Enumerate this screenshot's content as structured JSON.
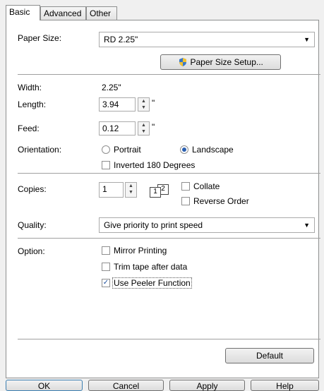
{
  "tabs": [
    {
      "label": "Basic"
    },
    {
      "label": "Advanced"
    },
    {
      "label": "Other"
    }
  ],
  "paper_size": {
    "label": "Paper Size:",
    "value": "RD 2.25\"",
    "setup_button": "Paper Size Setup..."
  },
  "width": {
    "label": "Width:",
    "value": "2.25\""
  },
  "length": {
    "label": "Length:",
    "value": "3.94",
    "unit": "\""
  },
  "feed": {
    "label": "Feed:",
    "value": "0.12",
    "unit": "\""
  },
  "orientation": {
    "label": "Orientation:",
    "portrait": "Portrait",
    "landscape": "Landscape",
    "selected": "landscape",
    "inverted": "Inverted 180 Degrees",
    "inverted_checked": false
  },
  "copies": {
    "label": "Copies:",
    "value": "1",
    "collate": "Collate",
    "collate_checked": false,
    "reverse": "Reverse Order",
    "reverse_checked": false,
    "icon_digits": [
      "1",
      "2"
    ]
  },
  "quality": {
    "label": "Quality:",
    "value": "Give priority to print speed"
  },
  "option": {
    "label": "Option:",
    "items": [
      {
        "label": "Mirror Printing",
        "checked": false
      },
      {
        "label": "Trim tape after data",
        "checked": false
      },
      {
        "label": "Use Peeler Function",
        "checked": true
      }
    ]
  },
  "default_button": "Default",
  "footer": {
    "ok": "OK",
    "cancel": "Cancel",
    "apply": "Apply",
    "help": "Help"
  }
}
